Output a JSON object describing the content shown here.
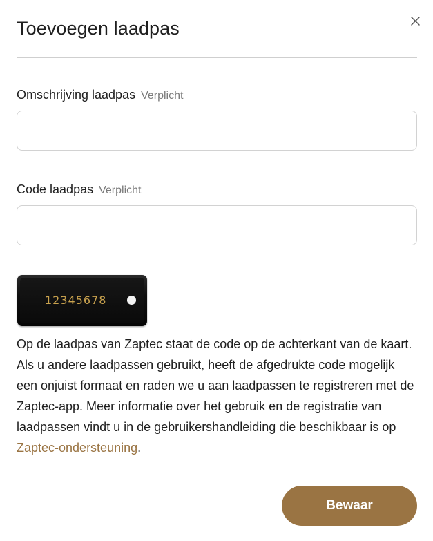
{
  "dialog": {
    "title": "Toevoegen laadpas",
    "close_icon": "close-icon"
  },
  "fields": {
    "description": {
      "label": "Omschrijving laadpas",
      "required": "Verplicht",
      "value": ""
    },
    "code": {
      "label": "Code laadpas",
      "required": "Verplicht",
      "value": ""
    }
  },
  "card_example": {
    "code": "12345678"
  },
  "info": {
    "text": "Op de laadpas van Zaptec staat de code op de achterkant van de kaart. Als u andere laadpassen gebruikt, heeft de afgedrukte code mogelijk een onjuist formaat en raden we u aan laadpassen te registreren met de Zaptec-app. Meer informatie over het gebruik en de registratie van laadpassen vindt u in de gebruikershandleiding die beschikbaar is op ",
    "link": "Zaptec-ondersteuning",
    "end": "."
  },
  "actions": {
    "save_label": "Bewaar"
  },
  "colors": {
    "accent": "#9a7443",
    "card_code": "#c9a24e"
  }
}
